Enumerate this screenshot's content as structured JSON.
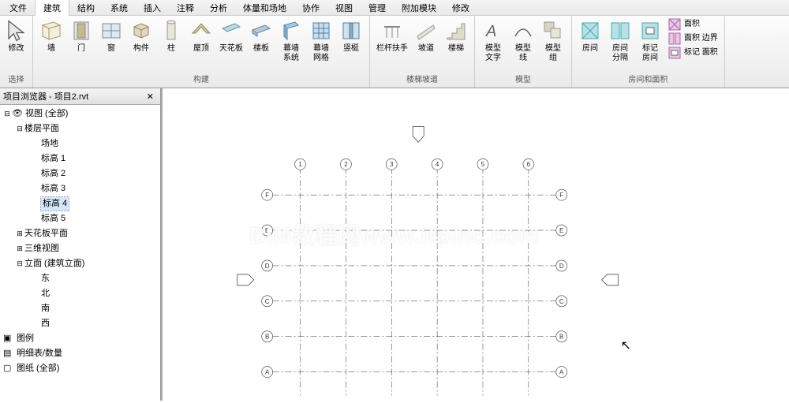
{
  "menu": {
    "items": [
      "文件",
      "建筑",
      "结构",
      "系统",
      "插入",
      "注释",
      "分析",
      "体量和场地",
      "协作",
      "视图",
      "管理",
      "附加模块",
      "修改"
    ],
    "active_index": 1
  },
  "ribbon": {
    "select": {
      "modify": "修改",
      "select": "选择"
    },
    "build": {
      "wall": "墙",
      "door": "门",
      "window": "窗",
      "component": "构件",
      "column": "柱",
      "roof": "屋顶",
      "ceiling": "天花板",
      "floor": "楼板",
      "curtain_system": "幕墙\n系统",
      "curtain_grid": "幕墙\n网格",
      "mullion": "竖梃",
      "label": "构建"
    },
    "circulation": {
      "railing": "栏杆扶手",
      "ramp": "坡道",
      "stair": "楼梯",
      "label": "楼梯坡道"
    },
    "model": {
      "text": "模型\n文字",
      "line": "模型\n线",
      "group": "模型\n组",
      "label": "模型"
    },
    "room": {
      "room": "房间",
      "separator": "房间\n分隔",
      "tag_room": "标记\n房间",
      "area": "面积",
      "area_boundary": "面积 边界",
      "tag_area": "标记 面积",
      "label": "房间和面积"
    }
  },
  "browser": {
    "title": "项目浏览器 - 项目2.rvt",
    "nodes": {
      "views_all": "视图 (全部)",
      "floor_plans": "楼层平面",
      "site": "场地",
      "lvl1": "标高 1",
      "lvl2": "标高 2",
      "lvl3": "标高 3",
      "lvl4": "标高 4",
      "lvl5": "标高 5",
      "ceiling_plans": "天花板平面",
      "views_3d": "三维视图",
      "elevations": "立面 (建筑立面)",
      "east": "东",
      "north": "北",
      "south": "南",
      "west": "西",
      "legends": "图例",
      "schedules": "明细表/数量",
      "sheets": "图纸 (全部)"
    },
    "selected": "lvl4"
  },
  "canvas": {
    "cols": [
      "1",
      "2",
      "3",
      "4",
      "5",
      "6"
    ],
    "rows": [
      "F",
      "E",
      "D",
      "C",
      "B",
      "A"
    ],
    "watermark": "BIM教程网www.ifpinc.com"
  }
}
